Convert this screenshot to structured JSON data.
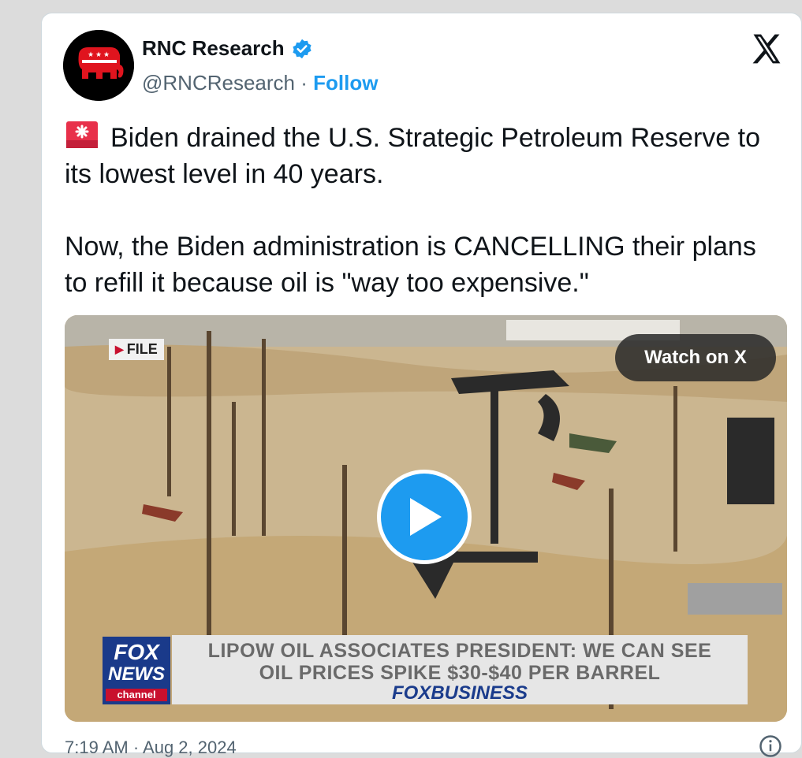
{
  "tweet": {
    "author_name": "RNC Research",
    "handle": "@RNCResearch",
    "separator": "·",
    "follow_label": "Follow",
    "paragraphs": [
      "Biden drained the U.S. Strategic Petroleum Reserve to its lowest level in 40 years.",
      "Now, the Biden administration is CANCELLING their plans to refill it because oil is \"way too expensive.\""
    ],
    "timestamp": "7:19 AM · Aug 2, 2024"
  },
  "video": {
    "file_badge": "FILE",
    "watch_label": "Watch on X",
    "chyron_line1": "LIPOW OIL ASSOCIATES PRESIDENT: WE CAN SEE",
    "chyron_line2": "OIL PRICES SPIKE $30-$40 PER BARREL",
    "network_logo": "FOXBUSINESS",
    "corner_logo_line1": "FOX",
    "corner_logo_line2": "NEWS",
    "corner_logo_line3": "channel"
  },
  "icons": {
    "verified": "verified-badge-icon",
    "close": "x-logo-icon",
    "siren": "siren-emoji-icon",
    "play": "play-icon",
    "info": "info-icon"
  },
  "colors": {
    "link_blue": "#1d9bf0",
    "text": "#0f1419",
    "muted": "#536471",
    "gop_red": "#c8102e"
  }
}
